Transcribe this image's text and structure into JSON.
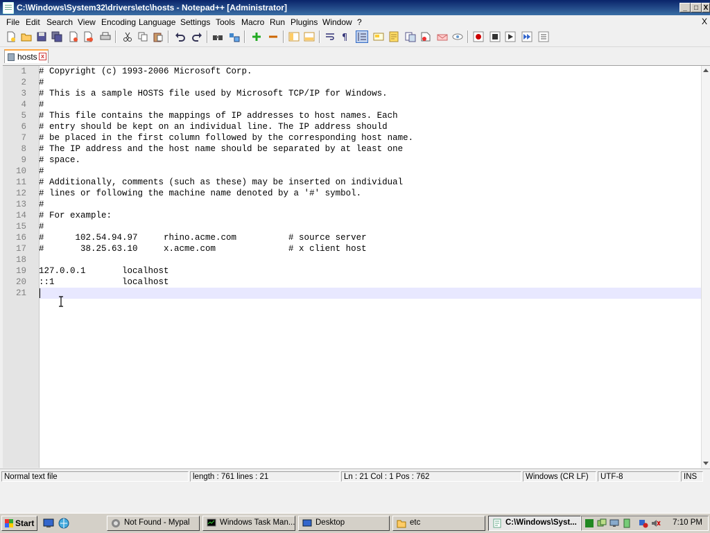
{
  "window": {
    "title": "C:\\Windows\\System32\\drivers\\etc\\hosts - Notepad++ [Administrator]",
    "minimize": "_",
    "maximize": "□",
    "close": "X"
  },
  "menu": {
    "items": [
      "File",
      "Edit",
      "Search",
      "View",
      "Encoding",
      "Language",
      "Settings",
      "Tools",
      "Macro",
      "Run",
      "Plugins",
      "Window",
      "?"
    ],
    "close_doc": "X"
  },
  "tab": {
    "label": "hosts",
    "close": "x"
  },
  "editor": {
    "lines": [
      "# Copyright (c) 1993-2006 Microsoft Corp.",
      "#",
      "# This is a sample HOSTS file used by Microsoft TCP/IP for Windows.",
      "#",
      "# This file contains the mappings of IP addresses to host names. Each",
      "# entry should be kept on an individual line. The IP address should",
      "# be placed in the first column followed by the corresponding host name.",
      "# The IP address and the host name should be separated by at least one",
      "# space.",
      "#",
      "# Additionally, comments (such as these) may be inserted on individual",
      "# lines or following the machine name denoted by a '#' symbol.",
      "#",
      "# For example:",
      "#",
      "#      102.54.94.97     rhino.acme.com          # source server",
      "#       38.25.63.10     x.acme.com              # x client host",
      "",
      "127.0.0.1       localhost",
      "::1             localhost",
      ""
    ],
    "line_numbers": [
      "1",
      "2",
      "3",
      "4",
      "5",
      "6",
      "7",
      "8",
      "9",
      "10",
      "11",
      "12",
      "13",
      "14",
      "15",
      "16",
      "17",
      "18",
      "19",
      "20",
      "21"
    ]
  },
  "status": {
    "file_type": "Normal text file",
    "length": "length : 761    lines : 21",
    "position": "Ln : 21    Col : 1    Pos : 762",
    "eol": "Windows (CR LF)",
    "encoding": "UTF-8",
    "mode": "INS"
  },
  "taskbar": {
    "start_label": "Start",
    "tasks": [
      {
        "label": "Not Found - Mypal"
      },
      {
        "label": "Windows Task Man..."
      },
      {
        "label": "Desktop"
      },
      {
        "label": "etc"
      },
      {
        "label": "C:\\Windows\\Syst..."
      }
    ],
    "clock": "7:10 PM"
  }
}
